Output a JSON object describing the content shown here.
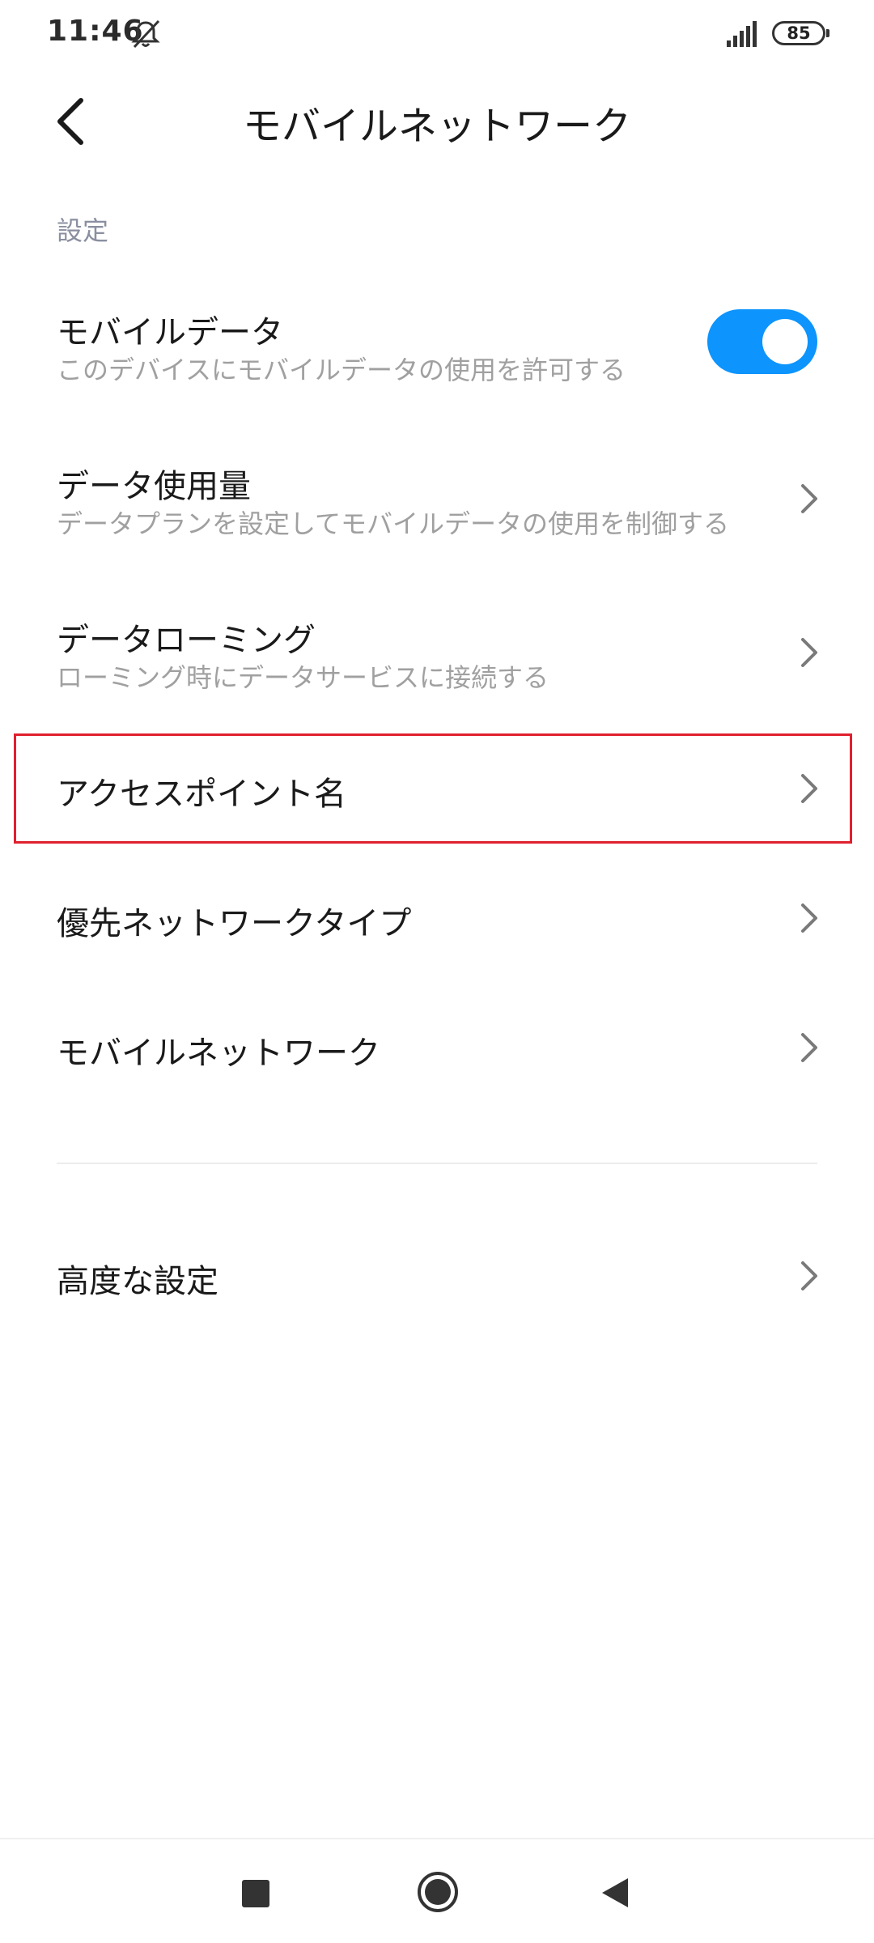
{
  "status_bar": {
    "time": "11:46",
    "battery": "85",
    "icons": [
      "mute-icon",
      "signal-icon",
      "battery-icon"
    ]
  },
  "header": {
    "title": "モバイルネットワーク",
    "back_icon": "chevron-left-icon"
  },
  "section": {
    "label": "設定"
  },
  "rows": [
    {
      "title": "モバイルデータ",
      "subtitle": "このデバイスにモバイルデータの使用を許可する",
      "control": "toggle",
      "toggle_on": true
    },
    {
      "title": "データ使用量",
      "subtitle": "データプランを設定してモバイルデータの使用を制御する",
      "control": "chevron"
    },
    {
      "title": "データローミング",
      "subtitle": "ローミング時にデータサービスに接続する",
      "control": "chevron"
    },
    {
      "title": "アクセスポイント名",
      "control": "chevron",
      "highlighted": true
    },
    {
      "title": "優先ネットワークタイプ",
      "control": "chevron"
    },
    {
      "title": "モバイルネットワーク",
      "control": "chevron"
    },
    {
      "title": "高度な設定",
      "control": "chevron"
    }
  ],
  "colors": {
    "toggle_on": "#0d94fd",
    "highlight_border": "#e0202e",
    "section_label": "#8a8fa0",
    "subtitle": "#a0a0a0"
  },
  "nav_bar": {
    "icons": [
      "recents-square-icon",
      "home-circle-icon",
      "back-triangle-icon"
    ]
  }
}
